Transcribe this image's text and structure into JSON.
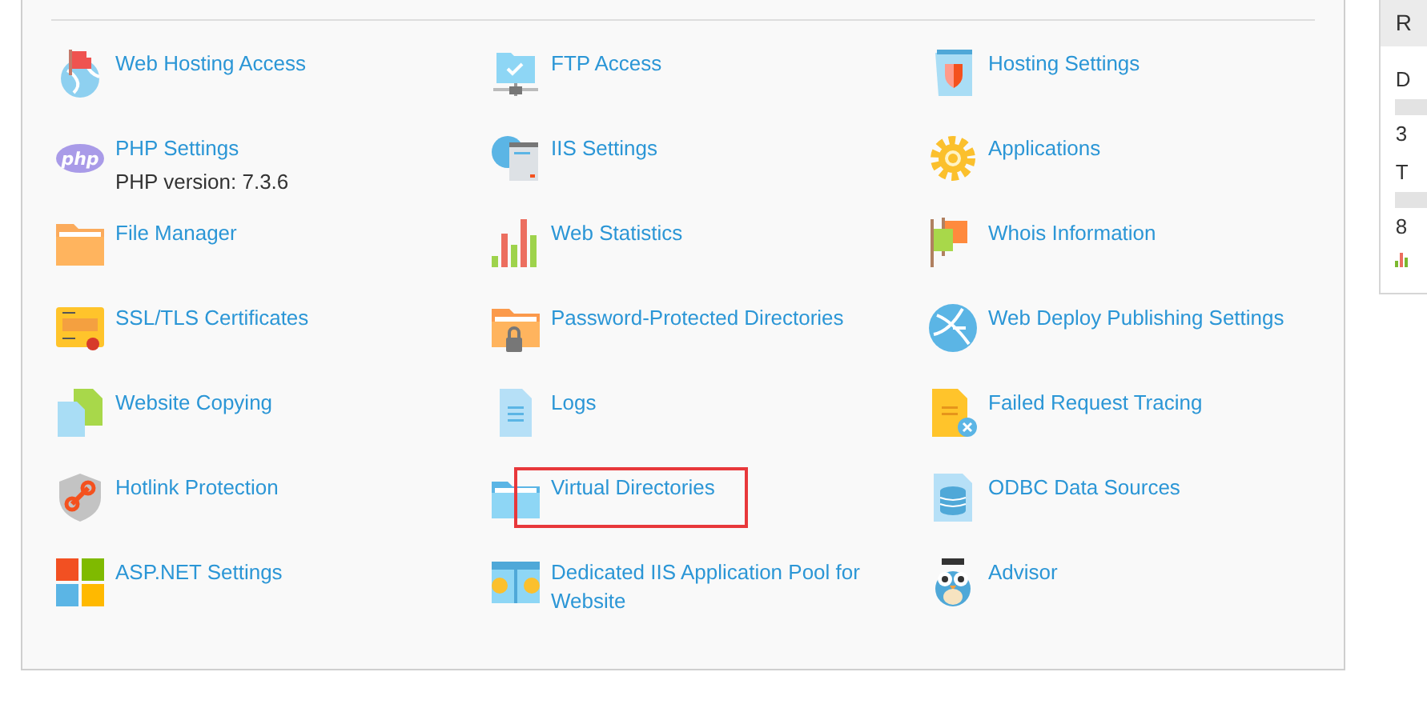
{
  "tools": [
    {
      "label": "Web Hosting Access",
      "highlighted": false
    },
    {
      "label": "FTP Access",
      "highlighted": false
    },
    {
      "label": "Hosting Settings",
      "highlighted": false
    },
    {
      "label": "PHP Settings",
      "icon_text": "php",
      "note": "PHP version: 7.3.6",
      "highlighted": false
    },
    {
      "label": "IIS Settings",
      "highlighted": false
    },
    {
      "label": "Applications",
      "highlighted": false
    },
    {
      "label": "File Manager",
      "highlighted": false
    },
    {
      "label": "Web Statistics",
      "highlighted": false
    },
    {
      "label": "Whois Information",
      "highlighted": false
    },
    {
      "label": "SSL/TLS Certificates",
      "highlighted": false
    },
    {
      "label": "Password-Protected Directories",
      "highlighted": false
    },
    {
      "label": "Web Deploy Publishing Settings",
      "highlighted": false
    },
    {
      "label": "Website Copying",
      "highlighted": false
    },
    {
      "label": "Logs",
      "highlighted": false
    },
    {
      "label": "Failed Request Tracing",
      "highlighted": false
    },
    {
      "label": "Hotlink Protection",
      "highlighted": false
    },
    {
      "label": "Virtual Directories",
      "highlighted": true
    },
    {
      "label": "ODBC Data Sources",
      "highlighted": false
    },
    {
      "label": "ASP.NET Settings",
      "highlighted": false
    },
    {
      "label": "Dedicated IIS Application Pool for Website",
      "highlighted": false
    },
    {
      "label": "Advisor",
      "highlighted": false
    }
  ],
  "side_panel": {
    "title": "R",
    "metrics": [
      {
        "label": "D",
        "reading": "3"
      },
      {
        "label": "T",
        "reading": "8"
      }
    ]
  }
}
